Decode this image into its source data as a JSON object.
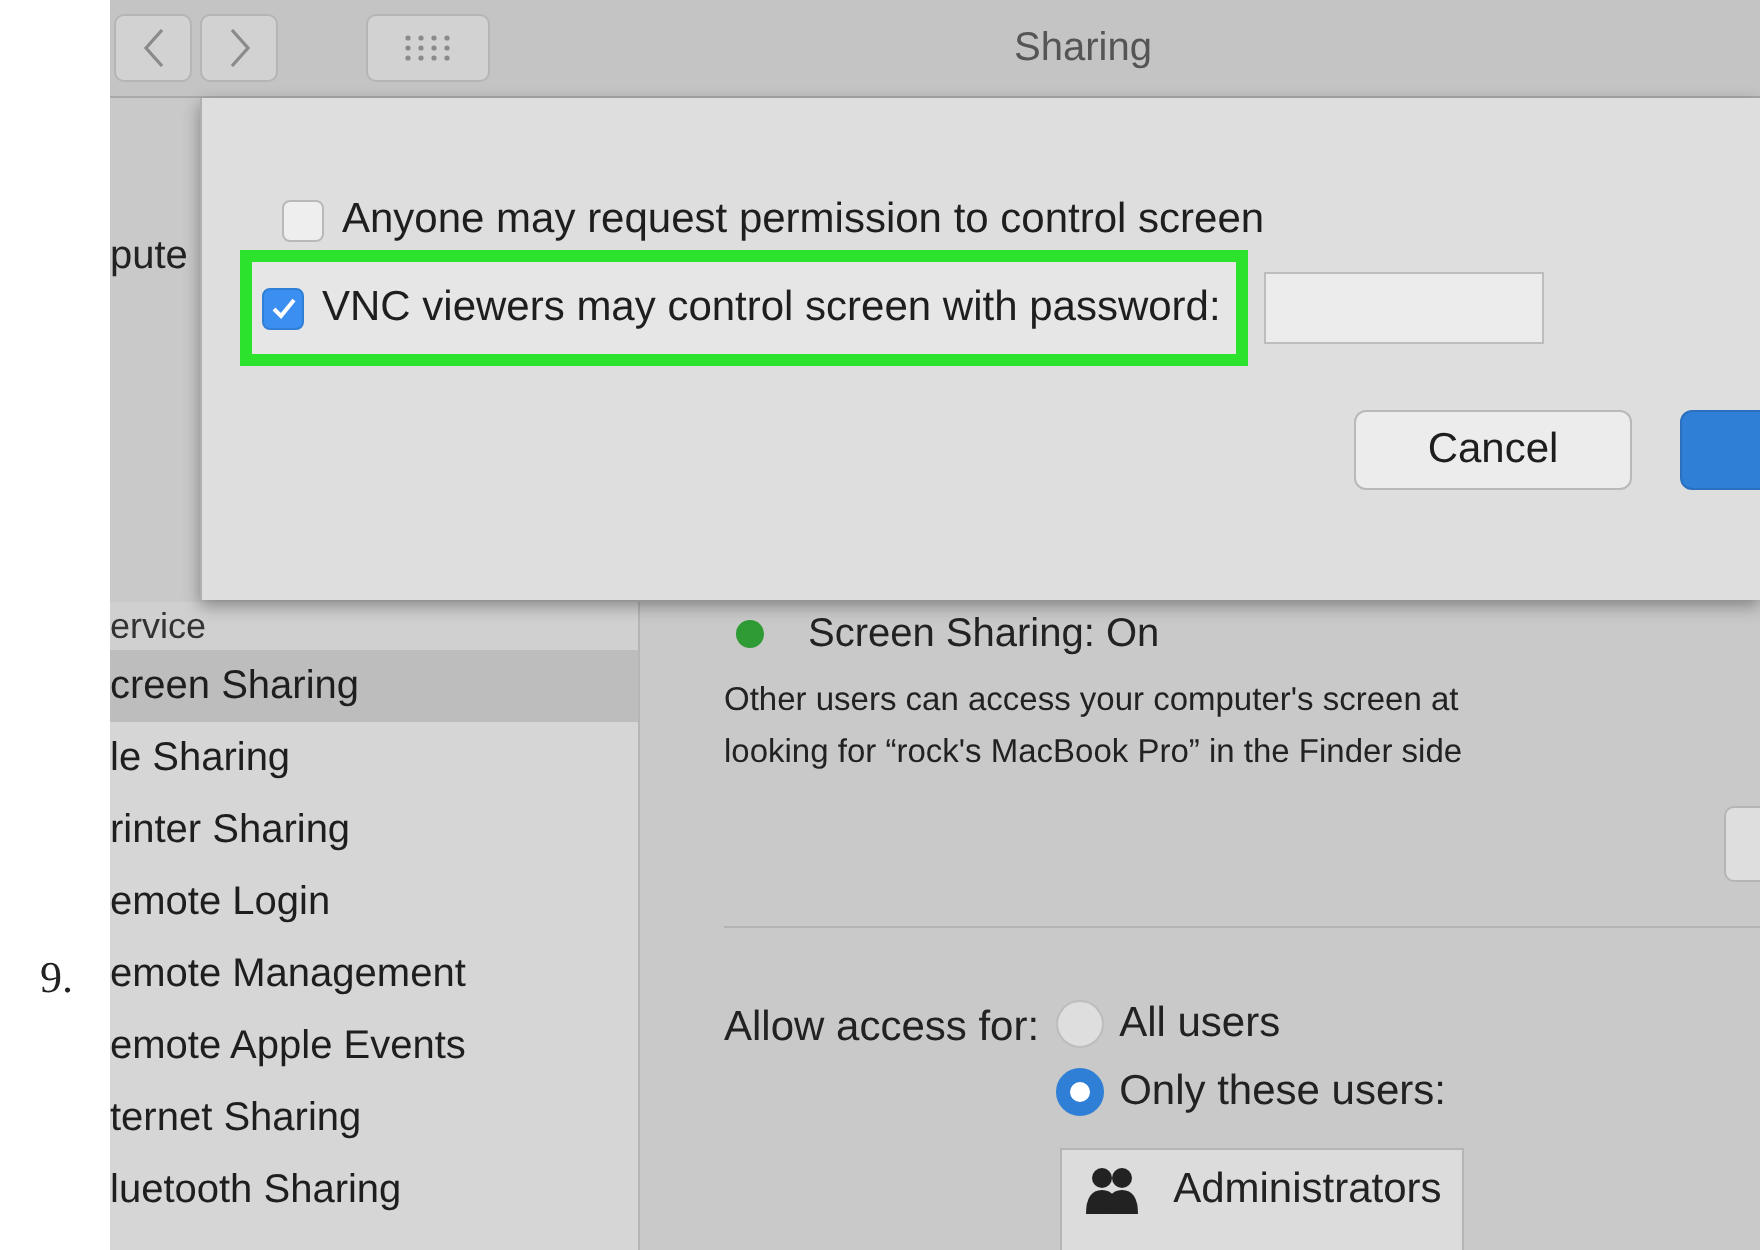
{
  "step_number": "9.",
  "window": {
    "title": "Sharing"
  },
  "computer_name_label": "pute",
  "sheet": {
    "options": [
      {
        "label": "Anyone may request permission to control screen",
        "checked": false,
        "highlighted": false
      },
      {
        "label": "VNC viewers may control screen with password:",
        "checked": true,
        "highlighted": true
      }
    ],
    "buttons": [
      {
        "label": "Cancel",
        "kind": "secondary"
      },
      {
        "kind": "primary"
      }
    ]
  },
  "sidebar": {
    "header": "ervice",
    "items": [
      {
        "label": "creen Sharing",
        "selected": true
      },
      {
        "label": "le Sharing",
        "selected": false
      },
      {
        "label": "rinter Sharing",
        "selected": false
      },
      {
        "label": "emote Login",
        "selected": false
      },
      {
        "label": "emote Management",
        "selected": false
      },
      {
        "label": "emote Apple Events",
        "selected": false
      },
      {
        "label": "ternet Sharing",
        "selected": false
      },
      {
        "label": "luetooth Sharing",
        "selected": false
      }
    ]
  },
  "status": {
    "label": "Screen Sharing: On",
    "on": true
  },
  "description": [
    "Other users can access your computer's screen at",
    "looking for “rock's MacBook Pro” in the Finder side"
  ],
  "access": {
    "label": "Allow access for:",
    "options": [
      {
        "label": "All users",
        "selected": false
      },
      {
        "label": "Only these users:",
        "selected": true
      }
    ]
  },
  "users": [
    "Administrators"
  ]
}
